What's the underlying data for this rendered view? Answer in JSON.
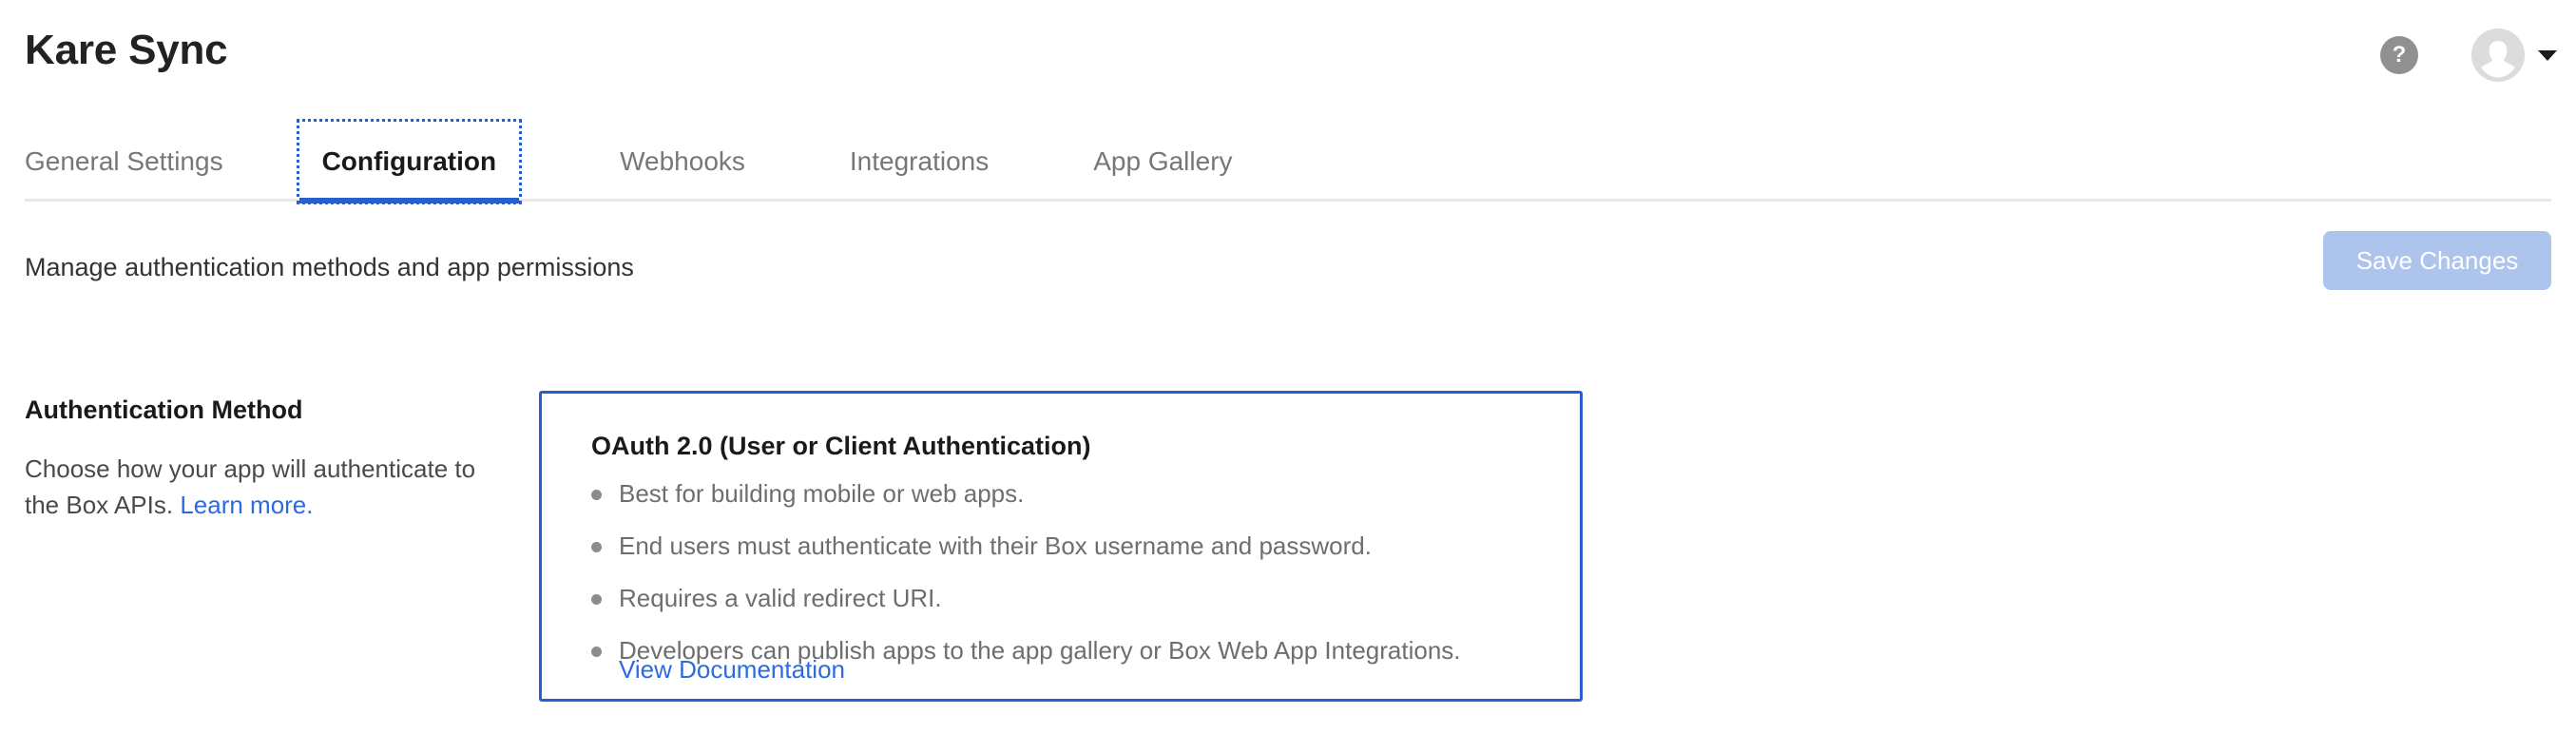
{
  "header": {
    "app_title": "Kare Sync",
    "help_icon_label": "?",
    "help_icon_name": "help-icon",
    "avatar_name": "user-avatar",
    "caret_name": "chevron-down-icon"
  },
  "tabs": [
    {
      "label": "General Settings",
      "active": false
    },
    {
      "label": "Configuration",
      "active": true
    },
    {
      "label": "Webhooks",
      "active": false
    },
    {
      "label": "Integrations",
      "active": false
    },
    {
      "label": "App Gallery",
      "active": false
    }
  ],
  "subheader": {
    "description": "Manage authentication methods and app permissions",
    "save_label": "Save Changes"
  },
  "left_panel": {
    "heading": "Authentication Method",
    "description_text": "Choose how your app will authenticate to the Box APIs. ",
    "link_label": "Learn more."
  },
  "auth_card": {
    "title": "OAuth 2.0 (User or Client Authentication)",
    "bullets": [
      "Best for building mobile or web apps.",
      "End users must authenticate with their Box username and password.",
      "Requires a valid redirect URI.",
      "Developers can publish apps to the app gallery or Box Web App Integrations."
    ],
    "doc_link_label": "View Documentation"
  },
  "colors": {
    "accent_blue": "#2660cf",
    "link_blue": "#2c6ae0",
    "save_disabled": "#adc4ed",
    "muted_text": "#6e6e6e",
    "divider": "#e8e8e8"
  }
}
